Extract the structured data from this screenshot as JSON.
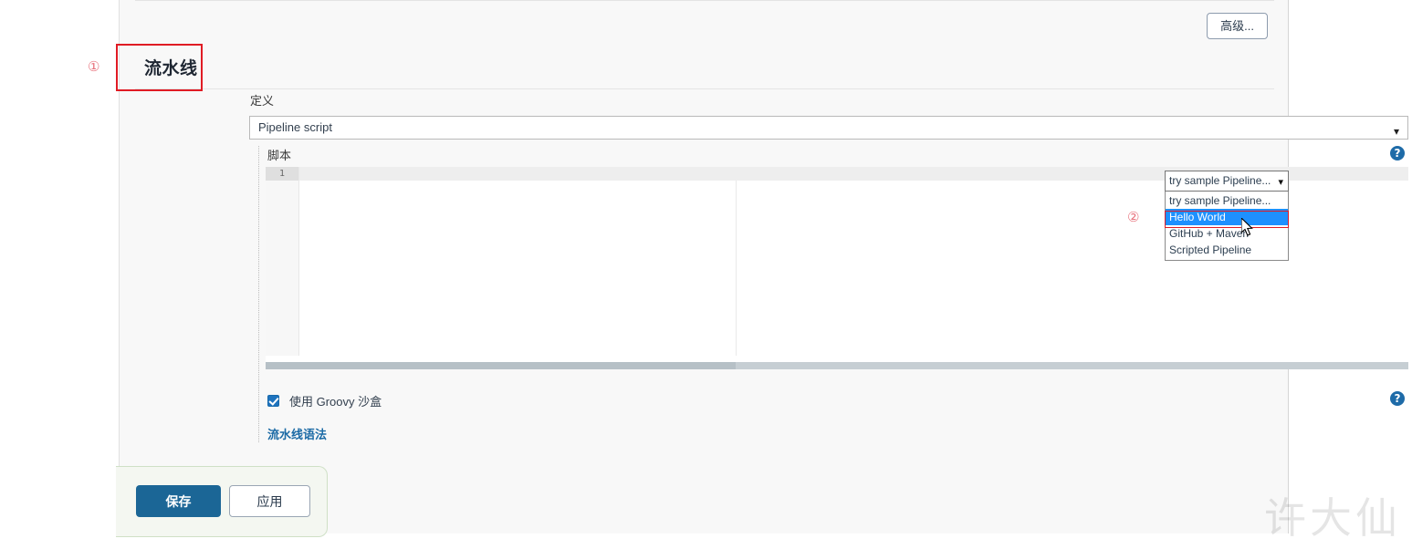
{
  "toolbar": {
    "advanced_label": "高级..."
  },
  "section": {
    "title": "流水线",
    "definition_label": "定义"
  },
  "definition": {
    "selected": "Pipeline script",
    "chevron": "⌄"
  },
  "script": {
    "label": "脚本",
    "line_number": "1",
    "content": ""
  },
  "sample_dropdown": {
    "selected": "try sample Pipeline...",
    "chevron": "⌄",
    "options": [
      "try sample Pipeline...",
      "Hello World",
      "GitHub + Maven",
      "Scripted Pipeline"
    ],
    "highlighted_index": 1
  },
  "sandbox": {
    "label": "使用 Groovy 沙盒",
    "checked": true
  },
  "links": {
    "pipeline_syntax": "流水线语法"
  },
  "buttons": {
    "save": "保存",
    "apply": "应用"
  },
  "help": {
    "glyph": "?"
  },
  "annotations": {
    "marker_one": "①",
    "marker_two": "②"
  },
  "watermark": {
    "text": "许大仙"
  },
  "colors": {
    "accent_blue": "#1b6696",
    "highlight_blue": "#1e90ff",
    "annotation_red": "#e01b24",
    "help_blue": "#1e6ba8",
    "link_blue": "#1b6aa5"
  }
}
